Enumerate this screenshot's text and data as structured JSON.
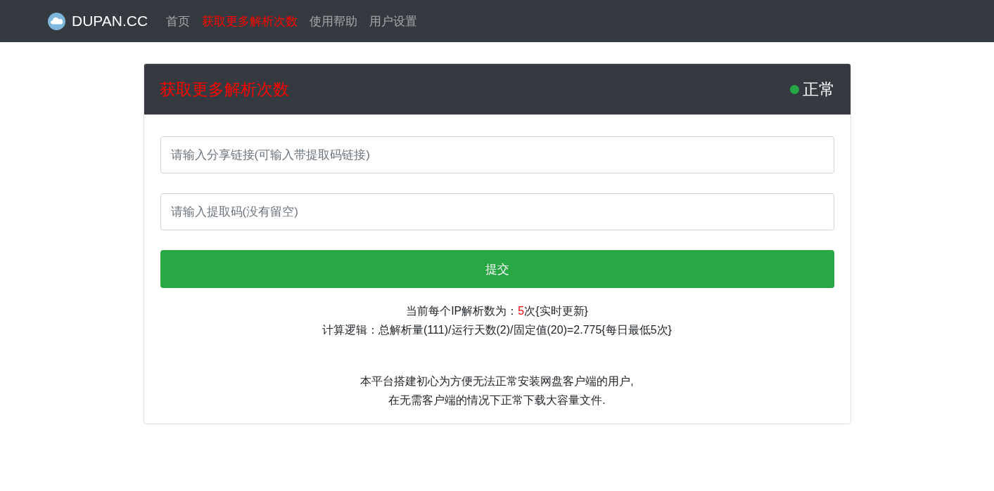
{
  "navbar": {
    "brand": "DUPAN.CC",
    "items": [
      {
        "label": "首页",
        "selected": false
      },
      {
        "label": "获取更多解析次数",
        "selected": true
      },
      {
        "label": "使用帮助",
        "selected": false
      },
      {
        "label": "用户设置",
        "selected": false
      }
    ]
  },
  "card": {
    "title": "获取更多解析次数",
    "status": {
      "label": "正常",
      "color": "#28a745"
    },
    "fields": [
      {
        "placeholder": "请输入分享链接(可输入带提取码链接)"
      },
      {
        "placeholder": "请输入提取码(没有留空)"
      }
    ],
    "submit": "提交",
    "info": [
      {
        "prefix": "当前每个IP解析数为：",
        "highlight": "5",
        "suffix": "次{实时更新}"
      },
      {
        "prefix": "计算逻辑：总解析量(111)/运行天数(2)/固定值(20)=2.775{每日最低5次}"
      }
    ],
    "notes": [
      "本平台搭建初心为方便无法正常安装网盘客户端的用户,",
      "在无需客户端的情况下正常下载大容量文件."
    ]
  }
}
